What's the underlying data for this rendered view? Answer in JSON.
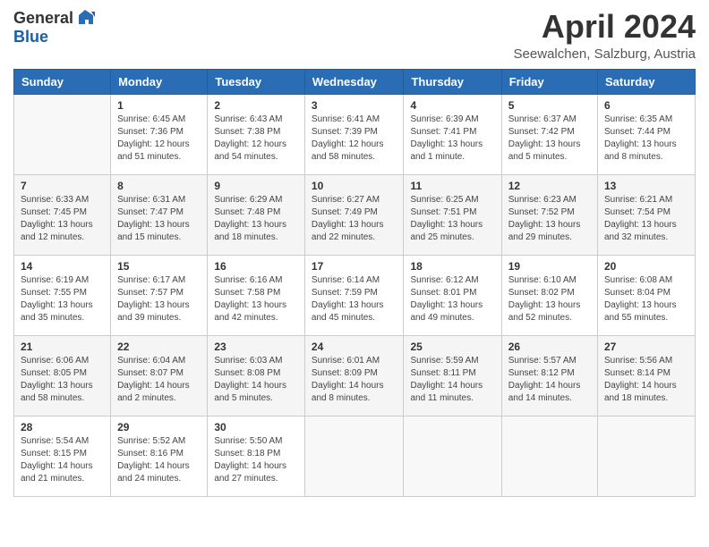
{
  "header": {
    "logo_general": "General",
    "logo_blue": "Blue",
    "month": "April 2024",
    "location": "Seewalchen, Salzburg, Austria"
  },
  "days_of_week": [
    "Sunday",
    "Monday",
    "Tuesday",
    "Wednesday",
    "Thursday",
    "Friday",
    "Saturday"
  ],
  "weeks": [
    {
      "shade": false,
      "days": [
        {
          "number": "",
          "info": ""
        },
        {
          "number": "1",
          "info": "Sunrise: 6:45 AM\nSunset: 7:36 PM\nDaylight: 12 hours\nand 51 minutes."
        },
        {
          "number": "2",
          "info": "Sunrise: 6:43 AM\nSunset: 7:38 PM\nDaylight: 12 hours\nand 54 minutes."
        },
        {
          "number": "3",
          "info": "Sunrise: 6:41 AM\nSunset: 7:39 PM\nDaylight: 12 hours\nand 58 minutes."
        },
        {
          "number": "4",
          "info": "Sunrise: 6:39 AM\nSunset: 7:41 PM\nDaylight: 13 hours\nand 1 minute."
        },
        {
          "number": "5",
          "info": "Sunrise: 6:37 AM\nSunset: 7:42 PM\nDaylight: 13 hours\nand 5 minutes."
        },
        {
          "number": "6",
          "info": "Sunrise: 6:35 AM\nSunset: 7:44 PM\nDaylight: 13 hours\nand 8 minutes."
        }
      ]
    },
    {
      "shade": true,
      "days": [
        {
          "number": "7",
          "info": "Sunrise: 6:33 AM\nSunset: 7:45 PM\nDaylight: 13 hours\nand 12 minutes."
        },
        {
          "number": "8",
          "info": "Sunrise: 6:31 AM\nSunset: 7:47 PM\nDaylight: 13 hours\nand 15 minutes."
        },
        {
          "number": "9",
          "info": "Sunrise: 6:29 AM\nSunset: 7:48 PM\nDaylight: 13 hours\nand 18 minutes."
        },
        {
          "number": "10",
          "info": "Sunrise: 6:27 AM\nSunset: 7:49 PM\nDaylight: 13 hours\nand 22 minutes."
        },
        {
          "number": "11",
          "info": "Sunrise: 6:25 AM\nSunset: 7:51 PM\nDaylight: 13 hours\nand 25 minutes."
        },
        {
          "number": "12",
          "info": "Sunrise: 6:23 AM\nSunset: 7:52 PM\nDaylight: 13 hours\nand 29 minutes."
        },
        {
          "number": "13",
          "info": "Sunrise: 6:21 AM\nSunset: 7:54 PM\nDaylight: 13 hours\nand 32 minutes."
        }
      ]
    },
    {
      "shade": false,
      "days": [
        {
          "number": "14",
          "info": "Sunrise: 6:19 AM\nSunset: 7:55 PM\nDaylight: 13 hours\nand 35 minutes."
        },
        {
          "number": "15",
          "info": "Sunrise: 6:17 AM\nSunset: 7:57 PM\nDaylight: 13 hours\nand 39 minutes."
        },
        {
          "number": "16",
          "info": "Sunrise: 6:16 AM\nSunset: 7:58 PM\nDaylight: 13 hours\nand 42 minutes."
        },
        {
          "number": "17",
          "info": "Sunrise: 6:14 AM\nSunset: 7:59 PM\nDaylight: 13 hours\nand 45 minutes."
        },
        {
          "number": "18",
          "info": "Sunrise: 6:12 AM\nSunset: 8:01 PM\nDaylight: 13 hours\nand 49 minutes."
        },
        {
          "number": "19",
          "info": "Sunrise: 6:10 AM\nSunset: 8:02 PM\nDaylight: 13 hours\nand 52 minutes."
        },
        {
          "number": "20",
          "info": "Sunrise: 6:08 AM\nSunset: 8:04 PM\nDaylight: 13 hours\nand 55 minutes."
        }
      ]
    },
    {
      "shade": true,
      "days": [
        {
          "number": "21",
          "info": "Sunrise: 6:06 AM\nSunset: 8:05 PM\nDaylight: 13 hours\nand 58 minutes."
        },
        {
          "number": "22",
          "info": "Sunrise: 6:04 AM\nSunset: 8:07 PM\nDaylight: 14 hours\nand 2 minutes."
        },
        {
          "number": "23",
          "info": "Sunrise: 6:03 AM\nSunset: 8:08 PM\nDaylight: 14 hours\nand 5 minutes."
        },
        {
          "number": "24",
          "info": "Sunrise: 6:01 AM\nSunset: 8:09 PM\nDaylight: 14 hours\nand 8 minutes."
        },
        {
          "number": "25",
          "info": "Sunrise: 5:59 AM\nSunset: 8:11 PM\nDaylight: 14 hours\nand 11 minutes."
        },
        {
          "number": "26",
          "info": "Sunrise: 5:57 AM\nSunset: 8:12 PM\nDaylight: 14 hours\nand 14 minutes."
        },
        {
          "number": "27",
          "info": "Sunrise: 5:56 AM\nSunset: 8:14 PM\nDaylight: 14 hours\nand 18 minutes."
        }
      ]
    },
    {
      "shade": false,
      "days": [
        {
          "number": "28",
          "info": "Sunrise: 5:54 AM\nSunset: 8:15 PM\nDaylight: 14 hours\nand 21 minutes."
        },
        {
          "number": "29",
          "info": "Sunrise: 5:52 AM\nSunset: 8:16 PM\nDaylight: 14 hours\nand 24 minutes."
        },
        {
          "number": "30",
          "info": "Sunrise: 5:50 AM\nSunset: 8:18 PM\nDaylight: 14 hours\nand 27 minutes."
        },
        {
          "number": "",
          "info": ""
        },
        {
          "number": "",
          "info": ""
        },
        {
          "number": "",
          "info": ""
        },
        {
          "number": "",
          "info": ""
        }
      ]
    }
  ]
}
